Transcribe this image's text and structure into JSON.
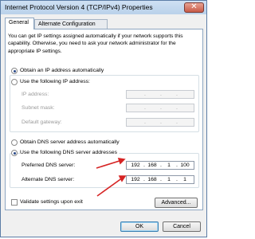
{
  "window": {
    "title": "Internet Protocol Version 4 (TCP/IPv4) Properties",
    "close_glyph": "✕"
  },
  "tabs": [
    {
      "label": "General"
    },
    {
      "label": "Alternate Configuration"
    }
  ],
  "intro_text": "You can get IP settings assigned automatically if your network supports this capability. Otherwise, you need to ask your network administrator for the appropriate IP settings.",
  "ip": {
    "auto_label": "Obtain an IP address automatically",
    "manual_label": "Use the following IP address:",
    "selected": "auto",
    "fields": [
      {
        "label": "IP address:"
      },
      {
        "label": "Subnet mask:"
      },
      {
        "label": "Default gateway:"
      }
    ]
  },
  "dns": {
    "auto_label": "Obtain DNS server address automatically",
    "manual_label": "Use the following DNS server addresses",
    "selected": "manual",
    "preferred_label": "Preferred DNS server:",
    "preferred_value": [
      "192",
      "168",
      "1",
      "100"
    ],
    "alternate_label": "Alternate DNS server:",
    "alternate_value": [
      "192",
      "168",
      "1",
      "1"
    ]
  },
  "validate_label": "Validate settings upon exit",
  "buttons": {
    "advanced": "Advanced...",
    "ok": "OK",
    "cancel": "Cancel"
  },
  "colors": {
    "accent_arrow": "#d62424",
    "title_bar": "#b9d1ea"
  }
}
